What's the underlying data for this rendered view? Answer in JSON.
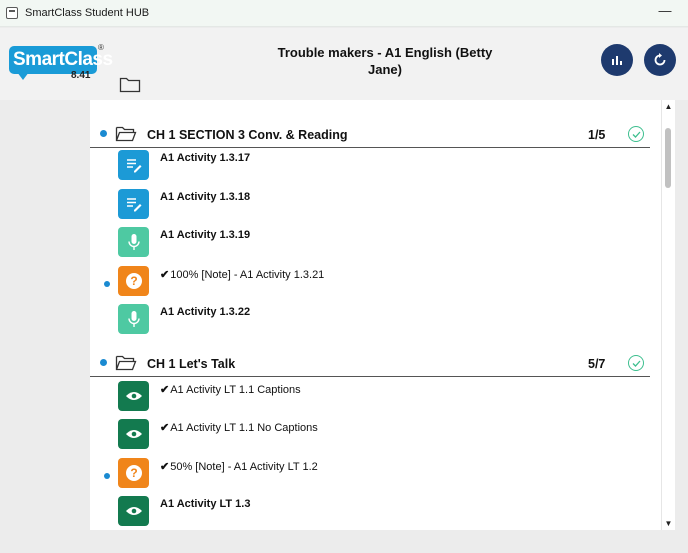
{
  "window": {
    "title": "SmartClass Student HUB",
    "minimize": "—"
  },
  "header": {
    "logo_text": "SmartClass",
    "logo_reg": "®",
    "version": "8.41",
    "course_title": "Trouble makers - A1 English (Betty Jane)"
  },
  "colors": {
    "accent": "#1e3a6e",
    "brand": "#1a9bd7",
    "done": "#3ebf8f"
  },
  "sections": [
    {
      "title": "CH 1 SECTION 3 Conv. & Reading",
      "count": "1/5",
      "items": [
        {
          "label": "A1 Activity 1.3.17",
          "type": "edit",
          "completed": false
        },
        {
          "label": "A1 Activity 1.3.18",
          "type": "edit",
          "completed": false
        },
        {
          "label": "A1 Activity 1.3.19",
          "type": "mic",
          "completed": false
        },
        {
          "label": "100% [Note] - A1 Activity 1.3.21",
          "type": "question",
          "completed": true
        },
        {
          "label": "A1 Activity 1.3.22",
          "type": "mic",
          "completed": false
        }
      ]
    },
    {
      "title": "CH 1 Let's Talk",
      "count": "5/7",
      "items": [
        {
          "label": "A1 Activity LT 1.1 Captions",
          "type": "view",
          "completed": true
        },
        {
          "label": "A1 Activity LT 1.1 No Captions",
          "type": "view",
          "completed": true
        },
        {
          "label": "50% [Note] - A1 Activity LT 1.2",
          "type": "question",
          "completed": true
        },
        {
          "label": "A1 Activity LT 1.3",
          "type": "view",
          "completed": false
        }
      ]
    }
  ],
  "marks": {
    "tick": "✔"
  }
}
